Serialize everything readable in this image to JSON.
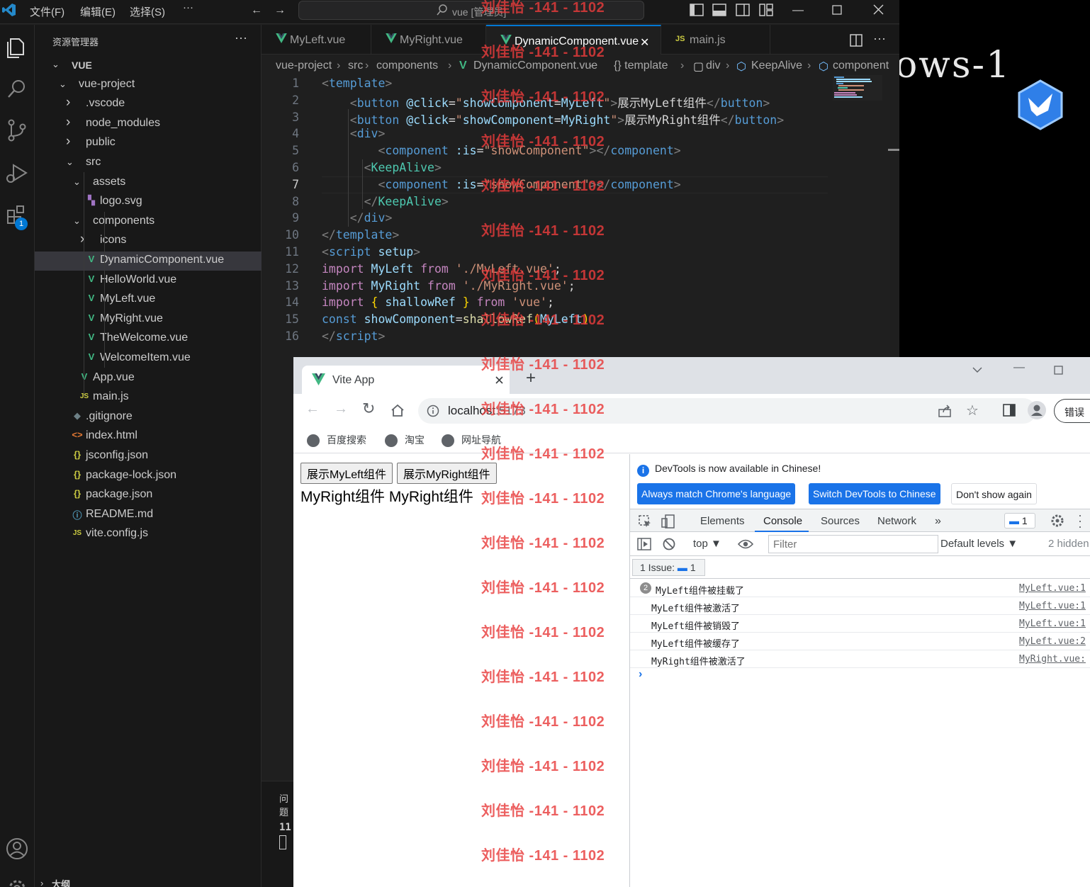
{
  "vscode": {
    "menu": [
      "文件(F)",
      "编辑(E)",
      "选择(S)",
      "···"
    ],
    "search_box": "vue [管理员]",
    "explorer_title": "资源管理器",
    "explorer_more": "···",
    "extensions_badge": "1",
    "tree": [
      {
        "label": "VUE",
        "depth": 0,
        "kind": "folder-open",
        "bold": true
      },
      {
        "label": "vue-project",
        "depth": 1,
        "kind": "folder-open"
      },
      {
        "label": ".vscode",
        "depth": 2,
        "kind": "folder"
      },
      {
        "label": "node_modules",
        "depth": 2,
        "kind": "folder"
      },
      {
        "label": "public",
        "depth": 2,
        "kind": "folder"
      },
      {
        "label": "src",
        "depth": 2,
        "kind": "folder-open"
      },
      {
        "label": "assets",
        "depth": 3,
        "kind": "folder-open"
      },
      {
        "label": "logo.svg",
        "depth": 4,
        "kind": "svg"
      },
      {
        "label": "components",
        "depth": 3,
        "kind": "folder-open"
      },
      {
        "label": "icons",
        "depth": 4,
        "kind": "folder"
      },
      {
        "label": "DynamicComponent.vue",
        "depth": 4,
        "kind": "vue",
        "active": true
      },
      {
        "label": "HelloWorld.vue",
        "depth": 4,
        "kind": "vue"
      },
      {
        "label": "MyLeft.vue",
        "depth": 4,
        "kind": "vue"
      },
      {
        "label": "MyRight.vue",
        "depth": 4,
        "kind": "vue"
      },
      {
        "label": "TheWelcome.vue",
        "depth": 4,
        "kind": "vue"
      },
      {
        "label": "WelcomeItem.vue",
        "depth": 4,
        "kind": "vue"
      },
      {
        "label": "App.vue",
        "depth": 3,
        "kind": "vue"
      },
      {
        "label": "main.js",
        "depth": 3,
        "kind": "js"
      },
      {
        "label": ".gitignore",
        "depth": 2,
        "kind": "git"
      },
      {
        "label": "index.html",
        "depth": 2,
        "kind": "html"
      },
      {
        "label": "jsconfig.json",
        "depth": 2,
        "kind": "json"
      },
      {
        "label": "package-lock.json",
        "depth": 2,
        "kind": "json"
      },
      {
        "label": "package.json",
        "depth": 2,
        "kind": "json"
      },
      {
        "label": "README.md",
        "depth": 2,
        "kind": "info"
      },
      {
        "label": "vite.config.js",
        "depth": 2,
        "kind": "js"
      }
    ],
    "outline_label": "大纲",
    "tabs": [
      {
        "label": "MyLeft.vue",
        "kind": "vue"
      },
      {
        "label": "MyRight.vue",
        "kind": "vue"
      },
      {
        "label": "DynamicComponent.vue",
        "kind": "vue",
        "active": true
      },
      {
        "label": "main.js",
        "kind": "js"
      }
    ],
    "breadcrumb": [
      "vue-project",
      "src",
      "components",
      "DynamicComponent.vue",
      "{} template",
      "div",
      "KeepAlive",
      "component"
    ],
    "current_line": 7,
    "code_lines": [
      [
        [
          "t-br",
          "<"
        ],
        [
          "t-tag",
          "template"
        ],
        [
          "t-br",
          ">"
        ]
      ],
      [
        [
          "t-txt",
          "    "
        ],
        [
          "t-br",
          "<"
        ],
        [
          "t-tag",
          "button"
        ],
        [
          "t-txt",
          " "
        ],
        [
          "t-attr",
          "@click"
        ],
        [
          "t-txt",
          "="
        ],
        [
          "t-str",
          "\""
        ],
        [
          "t-attr",
          "showComponent"
        ],
        [
          "t-txt",
          "="
        ],
        [
          "t-attr",
          "MyLeft"
        ],
        [
          "t-str",
          "\""
        ],
        [
          "t-br",
          ">"
        ],
        [
          "t-txt",
          "展示MyLeft组件"
        ],
        [
          "t-br",
          "</"
        ],
        [
          "t-tag",
          "button"
        ],
        [
          "t-br",
          ">"
        ]
      ],
      [
        [
          "t-txt",
          "    "
        ],
        [
          "t-br",
          "<"
        ],
        [
          "t-tag",
          "button"
        ],
        [
          "t-txt",
          " "
        ],
        [
          "t-attr",
          "@click"
        ],
        [
          "t-txt",
          "="
        ],
        [
          "t-str",
          "\""
        ],
        [
          "t-attr",
          "showComponent"
        ],
        [
          "t-txt",
          "="
        ],
        [
          "t-attr",
          "MyRight"
        ],
        [
          "t-str",
          "\""
        ],
        [
          "t-br",
          ">"
        ],
        [
          "t-txt",
          "展示MyRight组件"
        ],
        [
          "t-br",
          "</"
        ],
        [
          "t-tag",
          "button"
        ],
        [
          "t-br",
          ">"
        ]
      ],
      [
        [
          "t-txt",
          "    "
        ],
        [
          "t-br",
          "<"
        ],
        [
          "t-tag",
          "div"
        ],
        [
          "t-br",
          ">"
        ]
      ],
      [
        [
          "t-txt",
          "        "
        ],
        [
          "t-br",
          "<"
        ],
        [
          "t-tag",
          "component"
        ],
        [
          "t-txt",
          " "
        ],
        [
          "t-attr",
          ":is"
        ],
        [
          "t-txt",
          "="
        ],
        [
          "t-str",
          "\"showComponent\""
        ],
        [
          "t-br",
          "></"
        ],
        [
          "t-tag",
          "component"
        ],
        [
          "t-br",
          ">"
        ]
      ],
      [
        [
          "t-txt",
          "      "
        ],
        [
          "t-br",
          "<"
        ],
        [
          "t-tagc",
          "KeepAlive"
        ],
        [
          "t-br",
          ">"
        ]
      ],
      [
        [
          "t-txt",
          "        "
        ],
        [
          "t-br",
          "<"
        ],
        [
          "t-tag",
          "component"
        ],
        [
          "t-txt",
          " "
        ],
        [
          "t-attr",
          ":is"
        ],
        [
          "t-txt",
          "="
        ],
        [
          "t-str",
          "\"showComponent\""
        ],
        [
          "t-br",
          "></"
        ],
        [
          "t-tag",
          "component"
        ],
        [
          "t-br",
          ">"
        ]
      ],
      [
        [
          "t-txt",
          "      "
        ],
        [
          "t-br",
          "</"
        ],
        [
          "t-tagc",
          "KeepAlive"
        ],
        [
          "t-br",
          ">"
        ]
      ],
      [
        [
          "t-txt",
          "    "
        ],
        [
          "t-br",
          "</"
        ],
        [
          "t-tag",
          "div"
        ],
        [
          "t-br",
          ">"
        ]
      ],
      [
        [
          "t-br",
          "</"
        ],
        [
          "t-tag",
          "template"
        ],
        [
          "t-br",
          ">"
        ]
      ],
      [
        [
          "t-br",
          "<"
        ],
        [
          "t-tag",
          "script"
        ],
        [
          "t-txt",
          " "
        ],
        [
          "t-attr",
          "setup"
        ],
        [
          "t-br",
          ">"
        ]
      ],
      [
        [
          "t-kw",
          "import"
        ],
        [
          "t-txt",
          " "
        ],
        [
          "t-var",
          "MyLeft"
        ],
        [
          "t-txt",
          " "
        ],
        [
          "t-kw",
          "from"
        ],
        [
          "t-txt",
          " "
        ],
        [
          "t-str",
          "'./MyLeft.vue'"
        ],
        [
          "t-txt",
          ";"
        ]
      ],
      [
        [
          "t-kw",
          "import"
        ],
        [
          "t-txt",
          " "
        ],
        [
          "t-var",
          "MyRight"
        ],
        [
          "t-txt",
          " "
        ],
        [
          "t-kw",
          "from"
        ],
        [
          "t-txt",
          " "
        ],
        [
          "t-str",
          "'./MyRight.vue'"
        ],
        [
          "t-txt",
          ";"
        ]
      ],
      [
        [
          "t-kw",
          "import"
        ],
        [
          "t-txt",
          " "
        ],
        [
          "t-p1",
          "{"
        ],
        [
          "t-txt",
          " "
        ],
        [
          "t-var",
          "shallowRef"
        ],
        [
          "t-txt",
          " "
        ],
        [
          "t-p1",
          "}"
        ],
        [
          "t-txt",
          " "
        ],
        [
          "t-kw",
          "from"
        ],
        [
          "t-txt",
          " "
        ],
        [
          "t-str",
          "'vue'"
        ],
        [
          "t-txt",
          ";"
        ]
      ],
      [
        [
          "t-kw2",
          "const"
        ],
        [
          "t-txt",
          " "
        ],
        [
          "t-var",
          "showComponent"
        ],
        [
          "t-txt",
          "="
        ],
        [
          "t-fn",
          "shallowRef"
        ],
        [
          "t-p1",
          "("
        ],
        [
          "t-var",
          "MyLeft"
        ],
        [
          "t-p1",
          ")"
        ]
      ],
      [
        [
          "t-br",
          "</"
        ],
        [
          "t-tag",
          "script"
        ],
        [
          "t-br",
          ">"
        ]
      ]
    ],
    "panel_label": "问题",
    "panel_num": "11"
  },
  "desktop": {
    "text": "ows-1"
  },
  "chrome": {
    "tab_title": "Vite App",
    "url_host": "localhost",
    "url_port": ":5173",
    "profile_btn": "错误",
    "bookmarks": [
      "百度搜索",
      "淘宝",
      "网址导航"
    ]
  },
  "page": {
    "buttons": [
      "展示MyLeft组件",
      "展示MyRight组件"
    ],
    "text": "MyRight组件 MyRight组件"
  },
  "devtools": {
    "info": "DevTools is now available in Chinese!",
    "btn_match": "Always match Chrome's language",
    "btn_switch": "Switch DevTools to Chinese",
    "btn_dont": "Don't show again",
    "tabs": [
      "Elements",
      "Console",
      "Sources",
      "Network"
    ],
    "tab_more": "»",
    "active_tab": "Console",
    "issues_badge": "1",
    "context": "top",
    "filter_placeholder": "Filter",
    "levels": "Default levels",
    "hidden": "2 hidden",
    "issues_label": "1 Issue:",
    "issues_count": "1",
    "logs": [
      {
        "count": "2",
        "msg": "MyLeft组件被挂载了",
        "src": "MyLeft.vue:1"
      },
      {
        "count": "",
        "msg": "MyLeft组件被激活了",
        "src": "MyLeft.vue:1"
      },
      {
        "count": "",
        "msg": "MyLeft组件被销毁了",
        "src": "MyLeft.vue:1"
      },
      {
        "count": "",
        "msg": "MyLeft组件被缓存了",
        "src": "MyLeft.vue:2"
      },
      {
        "count": "",
        "msg": "MyRight组件被激活了",
        "src": "MyRight.vue:"
      }
    ]
  },
  "watermark": "刘佳怡 -141 - 1102",
  "colors": {
    "vue_green": "#41b883",
    "vue_dark": "#35495e",
    "watermark": "#e83c3c",
    "accent": "#1a73e8"
  }
}
